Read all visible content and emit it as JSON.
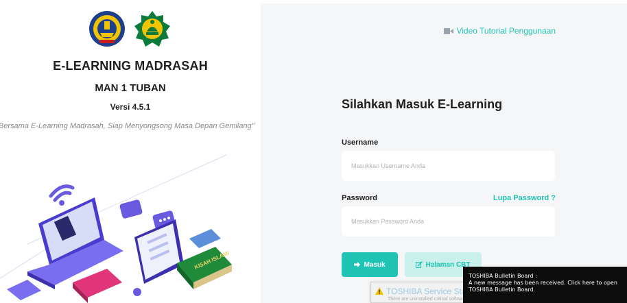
{
  "brand": {
    "app_title": "E-LEARNING MADRASAH",
    "school_name": "MAN 1 TUBAN",
    "version": "Versi 4.5.1",
    "slogan": "\"Bersama E-Learning Madrasah, Siap Menyongsong Masa Depan Gemilang\"",
    "logos": [
      "school-emblem-icon",
      "kemenag-emblem-icon"
    ],
    "illustration_labels": {
      "book1": "KISAH ISLAMI"
    }
  },
  "header": {
    "tutorial_link": "Video Tutorial Penggunaan",
    "tutorial_icon": "video-camera-icon"
  },
  "login": {
    "title": "Silahkan Masuk E-Learning",
    "username_label": "Username",
    "username_placeholder": "Masukkan Username Anda",
    "password_label": "Password",
    "password_placeholder": "Masukkan Password Anda",
    "forgot_link": "Lupa Password ?",
    "login_button": "Masuk",
    "cbt_button": "Halaman CBT"
  },
  "notifications": {
    "service_title": "TOSHIBA Service Station",
    "service_sub": "There are uninstalled critical software updates!",
    "bulletin_line1": "TOSHIBA Bulletin Board :",
    "bulletin_line2": "A new message has been received. Click here to open",
    "bulletin_line3": "TOSHIBA Bulletin Board."
  },
  "colors": {
    "accent": "#20c4b4",
    "accent_light": "#c9f0ea",
    "panel_bg": "#f5f6f8",
    "text_dark": "#1f1f1f"
  }
}
